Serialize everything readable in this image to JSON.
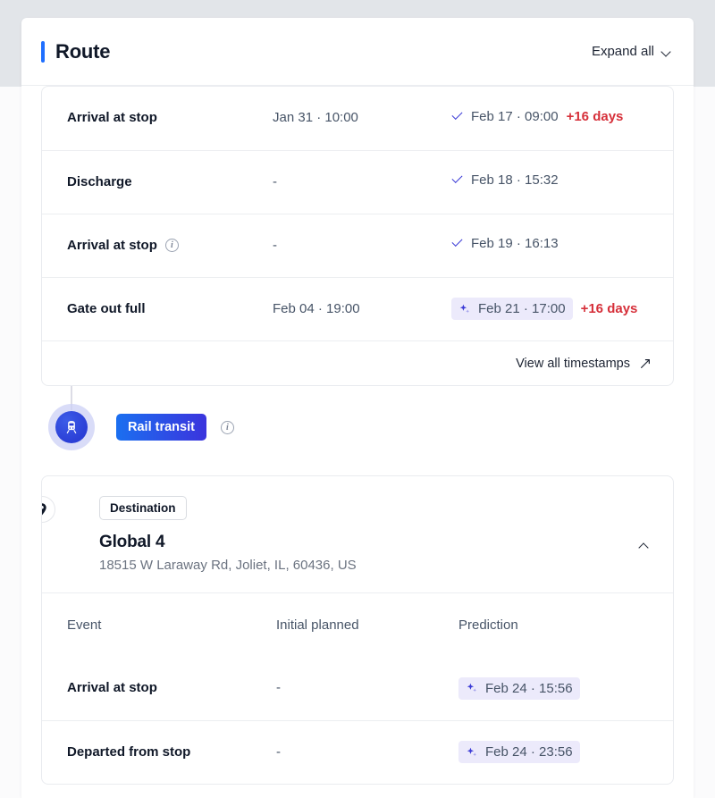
{
  "header": {
    "title": "Route",
    "accent_color": "#1f6fff",
    "expand_all_label": "Expand all",
    "chevron_icon": "chevron-down-icon"
  },
  "top_card": {
    "rows": [
      {
        "event": "Arrival at stop",
        "has_info": false,
        "initial_planned": "Jan 31 · 10:00",
        "prediction": "Feb 17 · 09:00",
        "prediction_style": "confirmed",
        "prediction_icon": "check-icon",
        "delay": "+16 days"
      },
      {
        "event": "Discharge",
        "has_info": false,
        "initial_planned": "-",
        "prediction": "Feb 18 · 15:32",
        "prediction_style": "confirmed",
        "prediction_icon": "check-icon",
        "delay": ""
      },
      {
        "event": "Arrival at stop",
        "has_info": true,
        "initial_planned": "-",
        "prediction": "Feb 19 · 16:13",
        "prediction_style": "confirmed",
        "prediction_icon": "check-icon",
        "delay": ""
      },
      {
        "event": "Gate out full",
        "has_info": false,
        "initial_planned": "Feb 04 · 19:00",
        "prediction": "Feb 21 · 17:00",
        "prediction_style": "predicted",
        "prediction_icon": "sparkle-icon",
        "delay": "+16 days"
      }
    ],
    "footer_link": "View all timestamps",
    "footer_icon": "expand-diagonal-icon"
  },
  "transit": {
    "mode_label": "Rail transit",
    "mode_icon": "train-icon",
    "info_icon": "info-icon",
    "pill_gradient_start": "#1b6ff0",
    "pill_gradient_end": "#3b34dd"
  },
  "destination": {
    "tag_label": "Destination",
    "pin_icon": "map-pin-icon",
    "name": "Global 4",
    "address": "18515 W Laraway Rd, Joliet, IL, 60436, US",
    "collapse_icon": "chevron-up-icon",
    "columns": [
      "Event",
      "Initial planned",
      "Prediction"
    ],
    "rows": [
      {
        "event": "Arrival at stop",
        "initial_planned": "-",
        "prediction": "Feb 24 · 15:56",
        "prediction_style": "predicted",
        "prediction_icon": "sparkle-icon"
      },
      {
        "event": "Departed from stop",
        "initial_planned": "-",
        "prediction": "Feb 24 · 23:56",
        "prediction_style": "predicted",
        "prediction_icon": "sparkle-icon"
      }
    ]
  },
  "colors": {
    "accent_blue": "#1f6fff",
    "delay_red": "#d6303a",
    "check_indigo": "#3b3bd6",
    "prediction_bg": "#eceafb",
    "timeline_purple": "#4b44c9"
  }
}
